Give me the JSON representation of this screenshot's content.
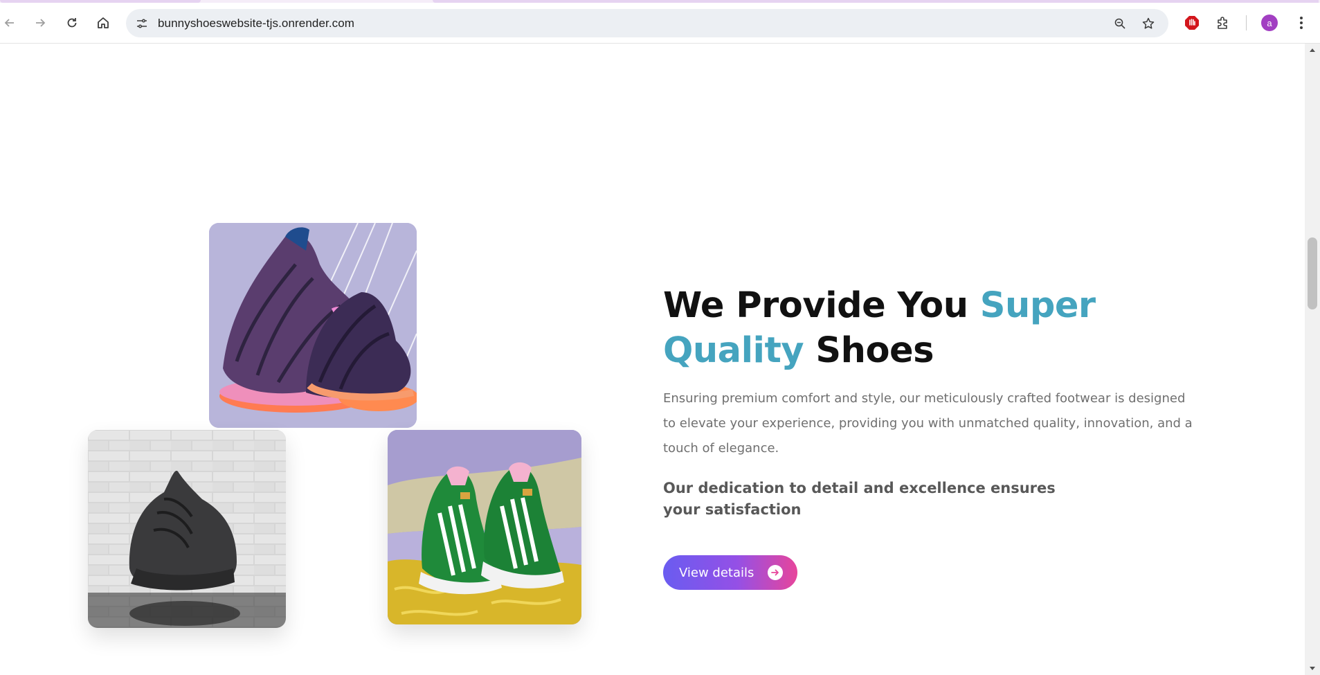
{
  "browser": {
    "url": "bunnyshoeswebsite-tjs.onrender.com",
    "profile_initial": "a",
    "icons": {
      "back": "arrow-left-icon",
      "forward": "arrow-right-icon",
      "reload": "reload-icon",
      "home": "home-icon",
      "site_info": "tune-icon",
      "zoom": "zoom-icon",
      "bookmark": "star-icon",
      "extension": "extension-icon",
      "menu": "kebab-menu-icon"
    }
  },
  "section": {
    "heading_part1": "We Provide You ",
    "heading_accent1": "Super",
    "heading_accent2": "Quality",
    "heading_part2": " Shoes",
    "description": "Ensuring premium comfort and style, our meticulously crafted footwear is designed to elevate your experience, providing you with unmatched quality, innovation, and a touch of elegance.",
    "subheading": "Our dedication to detail and excellence ensures your satisfaction",
    "cta_label": "View details",
    "accent_color": "#45a4bf"
  },
  "images": [
    {
      "name": "purple-knit-sneakers",
      "alt": "purple knit sneakers on lavender background"
    },
    {
      "name": "black-chunky-sneaker",
      "alt": "black chunky sneaker on brick wall background"
    },
    {
      "name": "green-gazelle-sneakers",
      "alt": "green sneakers with white stripes on fur rug"
    }
  ]
}
